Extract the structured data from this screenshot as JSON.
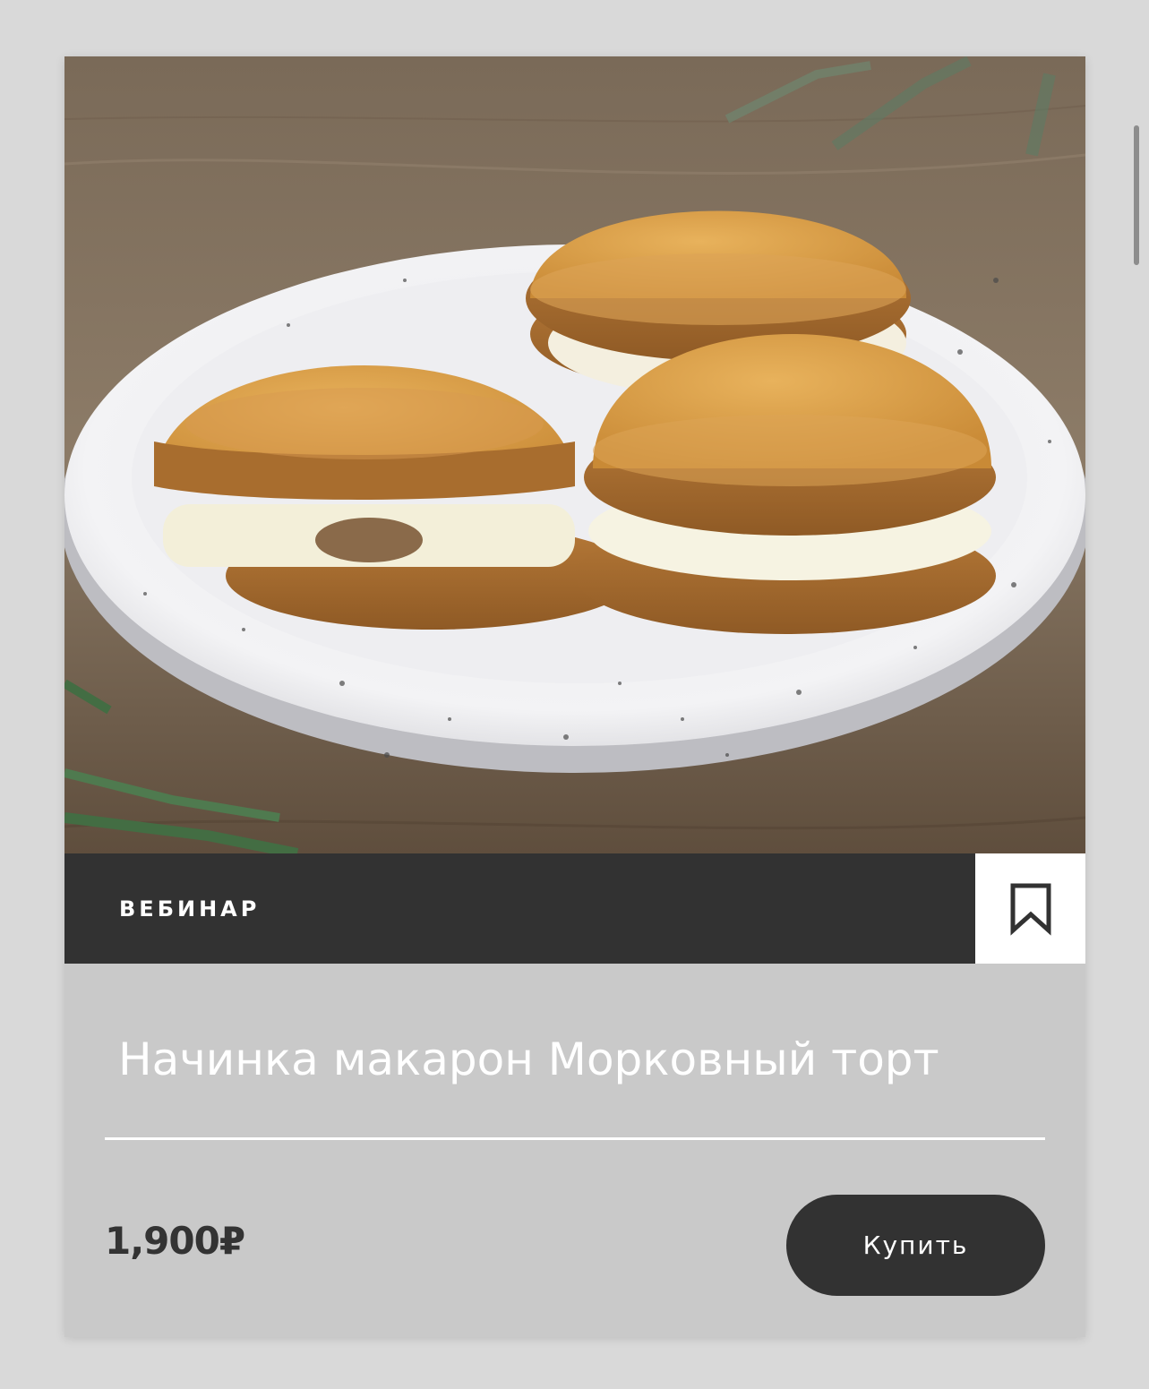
{
  "card": {
    "tag_label": "ВЕБИНАР",
    "title": "Начинка макарон Морковный торт",
    "price": "1,900₽",
    "buy_label": "Купить",
    "bookmark_icon": "bookmark-icon",
    "image_alt": "macarons-photo"
  },
  "colors": {
    "dark": "#323232",
    "card_bg": "#c9c9c9",
    "page_bg": "#d9d9d9"
  }
}
